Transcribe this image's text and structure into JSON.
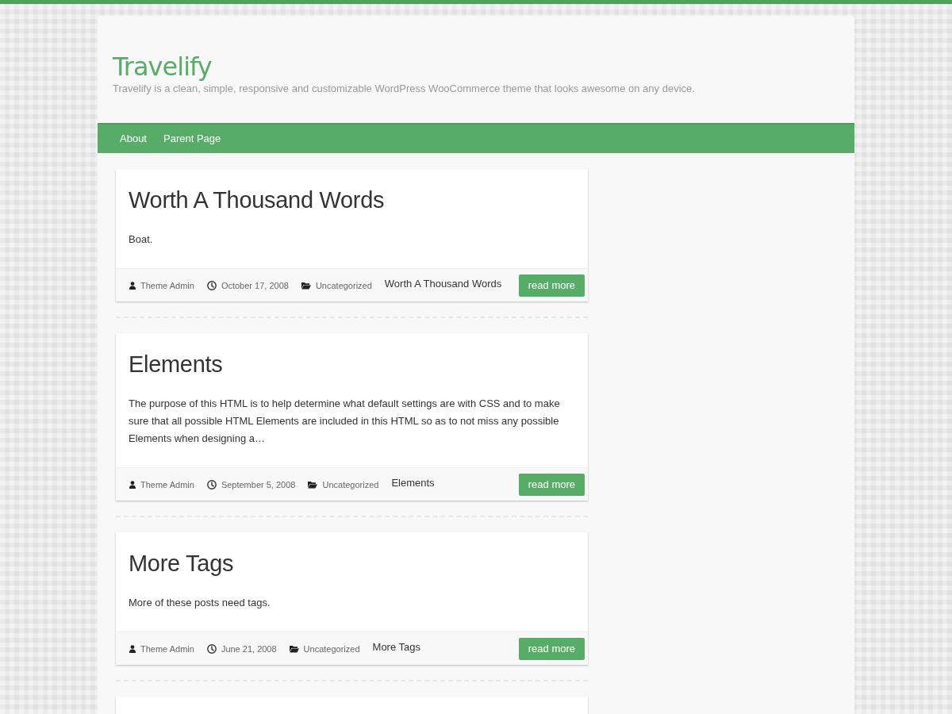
{
  "site": {
    "title": "Travelify",
    "tagline": "Travelify is a clean, simple, responsive and customizable WordPress WooCommerce theme that looks awesome on any device."
  },
  "nav": [
    {
      "label": "About"
    },
    {
      "label": "Parent Page"
    }
  ],
  "posts": [
    {
      "title": "Worth A Thousand Words",
      "excerpt": "Boat.",
      "author": "Theme Admin",
      "date": "October 17, 2008",
      "category": "Uncategorized",
      "footer_title": "Worth A Thousand Words",
      "button": "read more"
    },
    {
      "title": "Elements",
      "excerpt": "The purpose of this HTML is to help determine what default settings are with CSS and to make sure that all possible HTML Elements are included in this HTML so as to not miss any possible Elements when designing a…",
      "author": "Theme Admin",
      "date": "September 5, 2008",
      "category": "Uncategorized",
      "footer_title": "Elements",
      "button": "read more"
    },
    {
      "title": "More Tags",
      "excerpt": "More of these posts need tags.",
      "author": "Theme Admin",
      "date": "June 21, 2008",
      "category": "Uncategorized",
      "footer_title": "More Tags",
      "button": "read more"
    }
  ]
}
